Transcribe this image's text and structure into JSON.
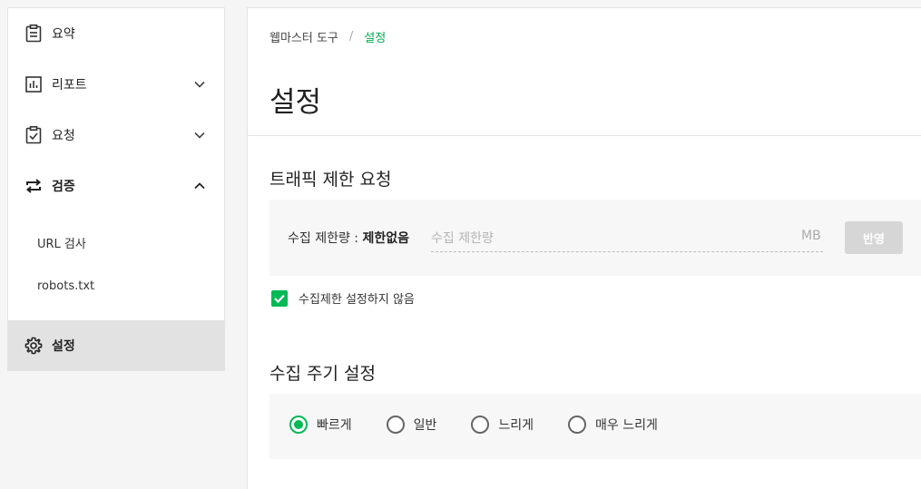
{
  "sidebar": {
    "items": [
      {
        "label": "요약",
        "icon": "clipboard-icon"
      },
      {
        "label": "리포트",
        "icon": "bar-chart-icon",
        "expanded": false
      },
      {
        "label": "요청",
        "icon": "clipboard-check-icon",
        "expanded": false
      },
      {
        "label": "검증",
        "icon": "swap-arrows-icon",
        "expanded": true
      },
      {
        "label": "설정",
        "icon": "gear-icon"
      }
    ],
    "sub_items": [
      {
        "label": "URL 검사"
      },
      {
        "label": "robots.txt"
      }
    ]
  },
  "breadcrumb": {
    "root": "웹마스터 도구",
    "separator": "/",
    "current": "설정"
  },
  "page_title": "설정",
  "traffic": {
    "title": "트래픽 제한 요청",
    "label_prefix": "수집 제한량 : ",
    "label_value": "제한없음",
    "input_placeholder": "수집 제한량",
    "input_value": "",
    "unit": "MB",
    "apply_label": "반영",
    "checkbox_label": "수집제한 설정하지 않음",
    "checkbox_checked": true
  },
  "crawl": {
    "title": "수집 주기 설정",
    "options": [
      {
        "label": "빠르게",
        "selected": true
      },
      {
        "label": "일반",
        "selected": false
      },
      {
        "label": "느리게",
        "selected": false
      },
      {
        "label": "매우 느리게",
        "selected": false
      }
    ]
  },
  "colors": {
    "accent": "#03b955",
    "active_bg": "#e2e2e2",
    "disabled_button": "#d6d6d6"
  }
}
